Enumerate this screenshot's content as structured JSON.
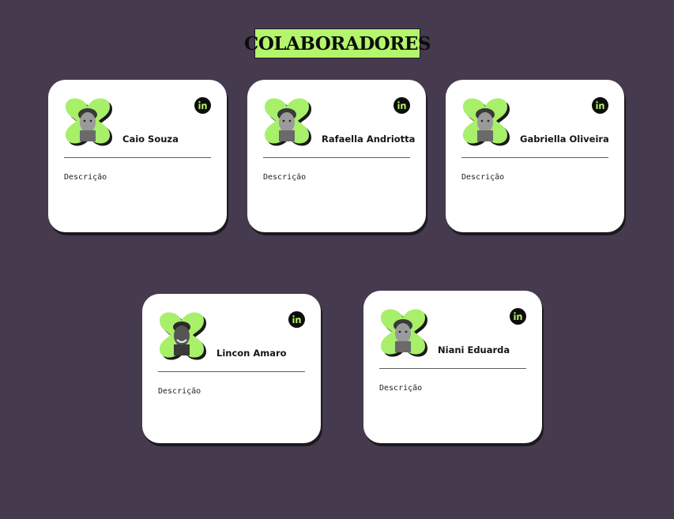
{
  "page": {
    "title": "COLABORADORES"
  },
  "colors": {
    "background": "#463a4e",
    "accent": "#b3f56b",
    "card": "#ffffff",
    "shadow": "#1d1a1f"
  },
  "collaborators": [
    {
      "name": "Caio Souza",
      "description": "Descrição",
      "icon": "linkedin-icon"
    },
    {
      "name": "Rafaella Andriotta",
      "description": "Descrição",
      "icon": "linkedin-icon"
    },
    {
      "name": "Gabriella Oliveira",
      "description": "Descrição",
      "icon": "linkedin-icon"
    },
    {
      "name": "Lincon Amaro",
      "description": "Descrição",
      "icon": "linkedin-icon"
    },
    {
      "name": "Niani Eduarda",
      "description": "Descrição",
      "icon": "linkedin-icon"
    }
  ]
}
